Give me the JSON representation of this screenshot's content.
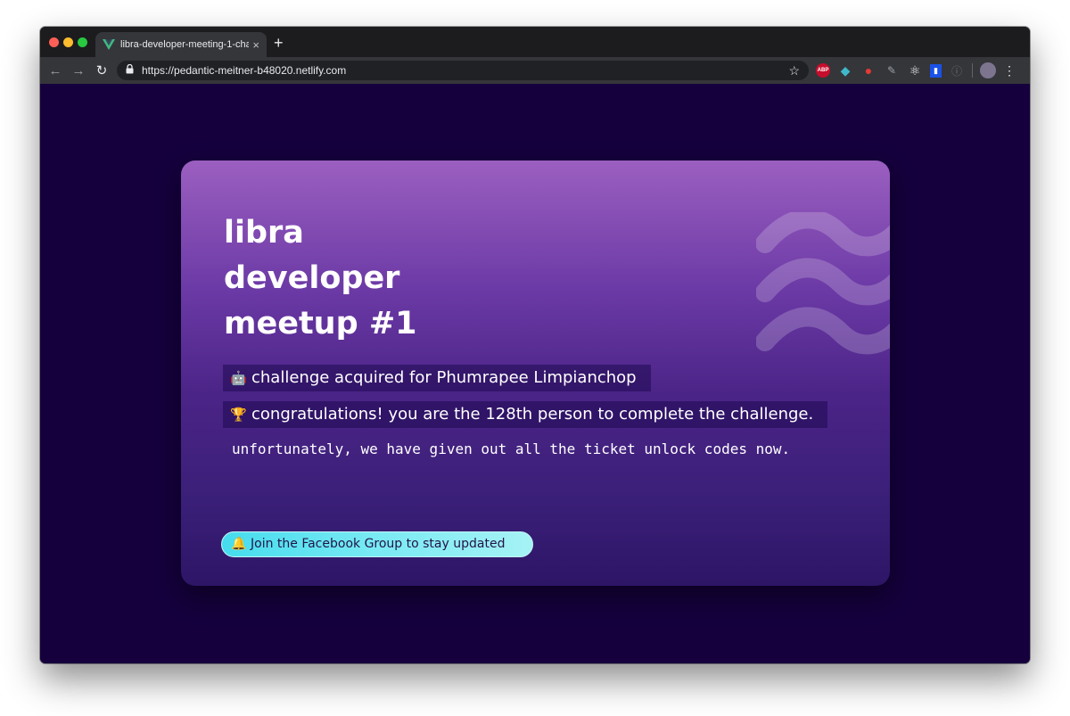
{
  "browser": {
    "tab_title": "libra-developer-meeting-1-cha",
    "tab_close": "×",
    "new_tab": "+",
    "url": "https://pedantic-meitner-b48020.netlify.com",
    "extensions": [
      "abp-icon",
      "diamond-icon",
      "color-picker-icon",
      "pen-icon",
      "react-devtools-icon",
      "blue-extension-icon",
      "info-icon"
    ],
    "abp_label": "ABP"
  },
  "card": {
    "heading_lines": [
      "libra",
      "developer",
      "meetup #1"
    ],
    "acquired_emoji": "🤖",
    "acquired_text": "challenge acquired for Phumrapee Limpianchop",
    "congrats_emoji": "🏆",
    "congrats_text": "congratulations! you are the 128th person to complete the challenge.",
    "unfortunate_text": "unfortunately, we have given out all the ticket unlock codes now.",
    "button_emoji": "🔔",
    "button_label": "Join the Facebook Group to stay updated"
  },
  "colors": {
    "page_background": "#15003d",
    "card_gradient_top": "#9b5fc0",
    "card_gradient_bottom": "#2e1566",
    "button_gradient_start": "#45dcee",
    "button_gradient_end": "#a6f2f5"
  }
}
